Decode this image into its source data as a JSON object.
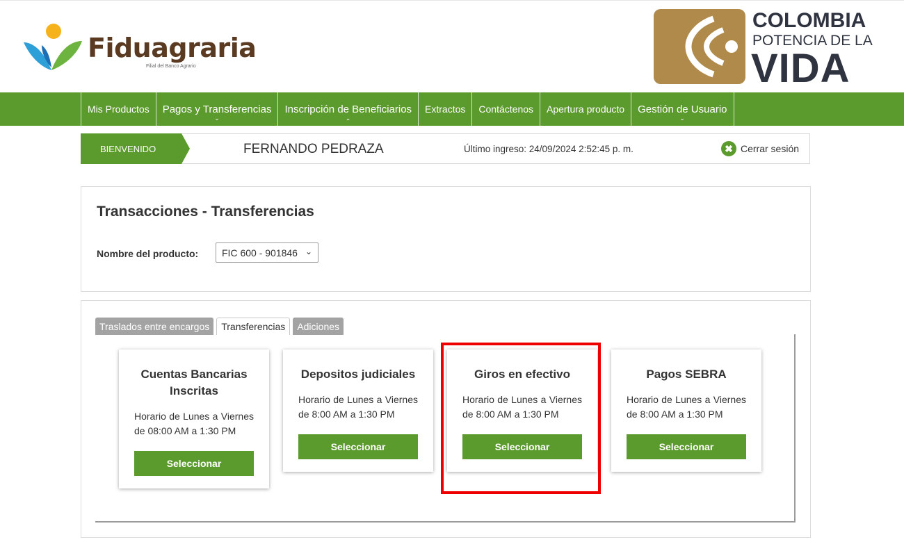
{
  "brand": {
    "name": "Fiduagraria",
    "tagline": "Filial del Banco Agrario",
    "gov_line1": "COLOMBIA",
    "gov_line2": "POTENCIA DE LA",
    "gov_line3": "VIDA",
    "colors": {
      "green": "#5b9a2d",
      "brown": "#5b3a22",
      "gold": "#b08a4a",
      "highlight": "#ee0000"
    }
  },
  "nav": {
    "items": [
      {
        "label": "Mis Productos",
        "dropdown": false
      },
      {
        "label": "Pagos y Transferencias",
        "dropdown": true
      },
      {
        "label": "Inscripción de Beneficiarios",
        "dropdown": true
      },
      {
        "label": "Extractos",
        "dropdown": false
      },
      {
        "label": "Contáctenos",
        "dropdown": false
      },
      {
        "label": "Apertura producto",
        "dropdown": false
      },
      {
        "label": "Gestión de Usuario",
        "dropdown": true
      }
    ]
  },
  "welcome": {
    "tag": "BIENVENIDO",
    "user_name": "FERNANDO PEDRAZA",
    "last_login": "Último ingreso: 24/09/2024 2:52:45 p. m.",
    "logout_label": "Cerrar sesión",
    "logout_icon": "close-circle-icon"
  },
  "transactions": {
    "title": "Transacciones - Transferencias",
    "product_label": "Nombre del producto:",
    "product_selected": "FIC 600 - 901846"
  },
  "tabs": [
    {
      "label": "Traslados entre encargos",
      "active": false
    },
    {
      "label": "Transferencias",
      "active": true
    },
    {
      "label": "Adiciones",
      "active": false
    }
  ],
  "cards": [
    {
      "title": "Cuentas Bancarias Inscritas",
      "text": "Horario de Lunes a Viernes de 08:00 AM a 1:30 PM",
      "button": "Seleccionar"
    },
    {
      "title": "Depositos judiciales",
      "text": "Horario de Lunes a Viernes de 8:00 AM a 1:30 PM",
      "button": "Seleccionar"
    },
    {
      "title": "Giros en efectivo",
      "text": "Horario de Lunes a Viernes de 8:00 AM a 1:30 PM",
      "button": "Seleccionar"
    },
    {
      "title": "Pagos SEBRA",
      "text": "Horario de Lunes a Viernes de 8:00 AM a 1:30 PM",
      "button": "Seleccionar"
    }
  ]
}
